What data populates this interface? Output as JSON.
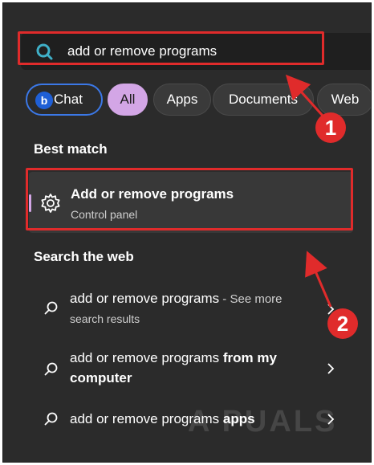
{
  "search": {
    "query": "add or remove programs"
  },
  "filters": {
    "chat": "Chat",
    "all": "All",
    "apps": "Apps",
    "documents": "Documents",
    "web": "Web"
  },
  "best_match": {
    "heading": "Best match",
    "title": "Add or remove programs",
    "subtitle": "Control panel",
    "icon": "gear-icon"
  },
  "search_web": {
    "heading": "Search the web",
    "items": [
      {
        "normal": "add or remove programs",
        "suffix": " - See more",
        "sub": "search results"
      },
      {
        "normal": "add or remove programs ",
        "bold": "from my",
        "sub_bold": "computer"
      },
      {
        "normal": "add or remove programs ",
        "bold": "apps"
      }
    ]
  },
  "annotations": {
    "badge_1": "1",
    "badge_2": "2",
    "color": "#e02b2b"
  },
  "watermark": "A PUALS",
  "colors": {
    "background": "#2b2b2b",
    "accent_chip": "#d3a6e6",
    "chat_border": "#3b78e7"
  }
}
